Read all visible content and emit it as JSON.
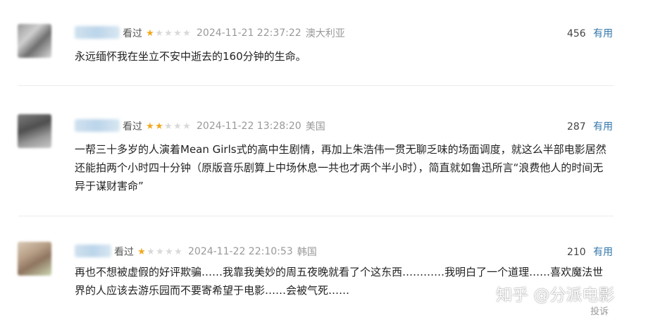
{
  "reviews": [
    {
      "watched": "看过",
      "rating": 1,
      "date": "2024-11-21 22:37:22",
      "location": "澳大利亚",
      "votes": "456",
      "useful_label": "有用",
      "content": "永远缅怀我在坐立不安中逝去的160分钟的生命。"
    },
    {
      "watched": "看过",
      "rating": 2,
      "date": "2024-11-22 13:28:20",
      "location": "美国",
      "votes": "287",
      "useful_label": "有用",
      "content": "一帮三十多岁的人演着Mean Girls式的高中生剧情，再加上朱浩伟一贯无聊乏味的场面调度，就这么半部电影居然还能拍两个小时四十分钟（原版音乐剧算上中场休息一共也才两个半小时），简直就如鲁迅所言“浪费他人的时间无异于谋财害命”"
    },
    {
      "watched": "看过",
      "rating": 1,
      "date": "2024-11-22 22:10:53",
      "location": "韩国",
      "votes": "210",
      "useful_label": "有用",
      "content": "再也不想被虚假的好评欺骗……我靠我美妙的周五夜晚就看了个这东西…………我明白了一个道理……喜欢魔法世界的人应该去游乐园而不要寄希望于电影……会被气死……"
    }
  ],
  "watermark": "知乎 @分派电影",
  "report_label": "投诉",
  "colors": {
    "star_on": "#f1a81e",
    "star_off": "#d9d9d9",
    "useful_link": "#3377aa",
    "meta_gray": "#999999"
  }
}
